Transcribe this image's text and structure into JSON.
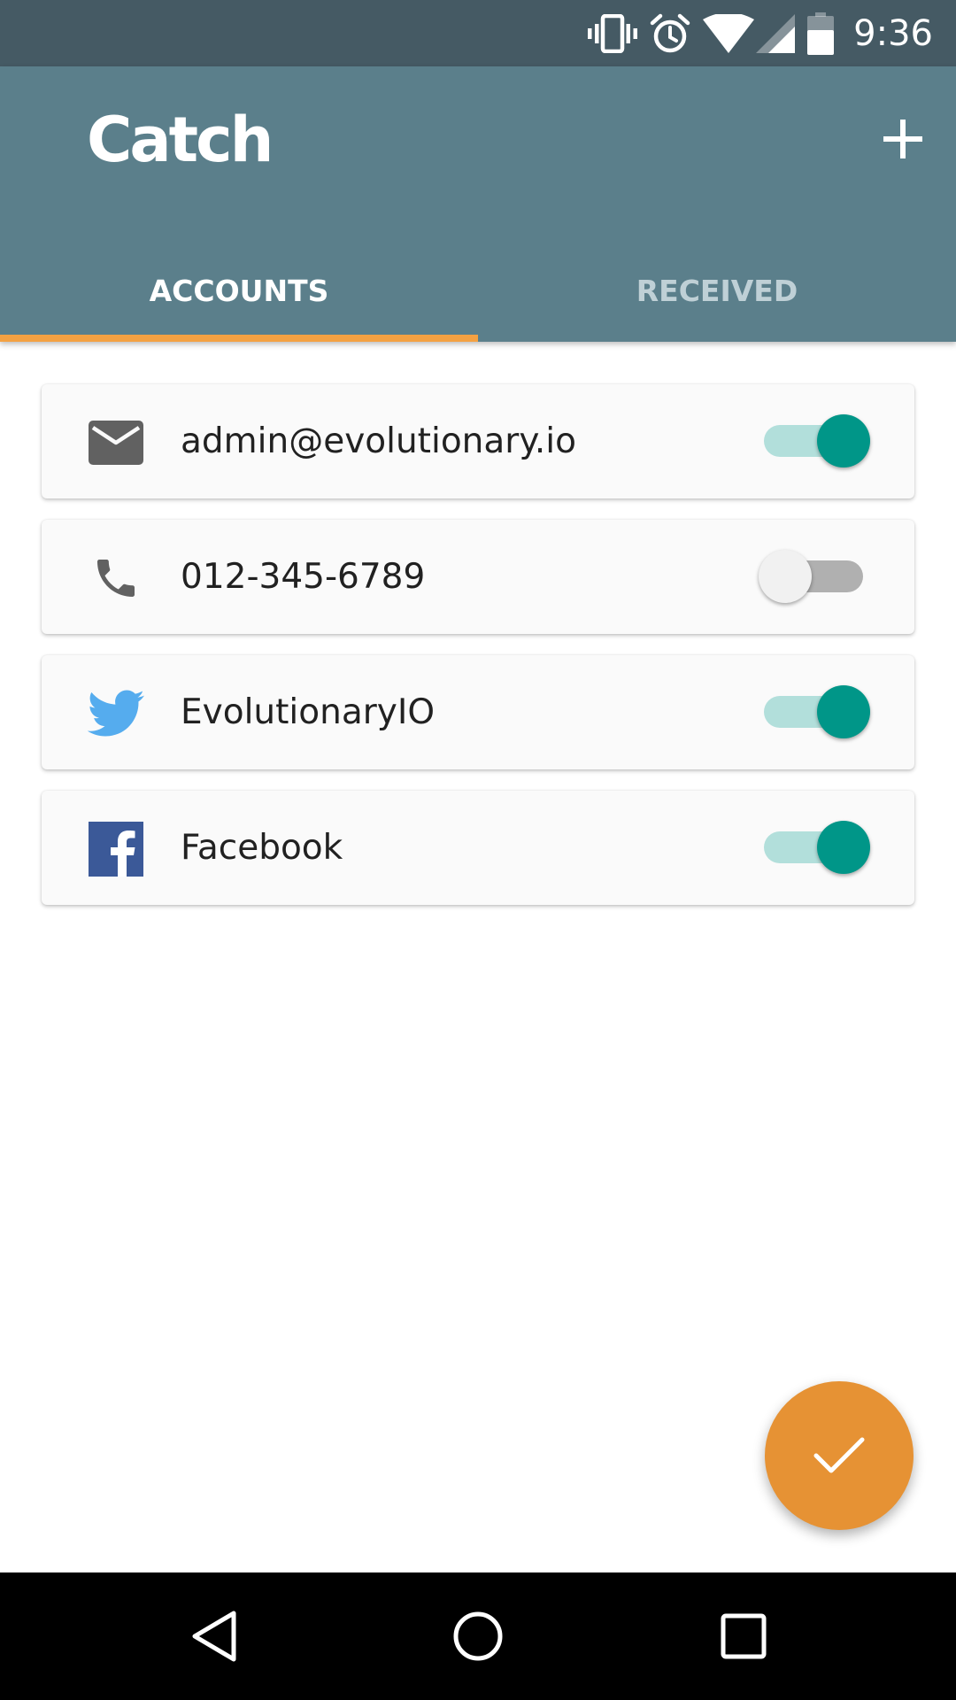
{
  "status_bar": {
    "time": "9:36",
    "icons": [
      "vibrate-icon",
      "alarm-icon",
      "wifi-icon",
      "signal-icon",
      "battery-icon"
    ]
  },
  "app_bar": {
    "title": "Catch",
    "add_icon": "plus-icon",
    "tabs": [
      {
        "label": "ACCOUNTS",
        "selected": true
      },
      {
        "label": "RECEIVED",
        "selected": false
      }
    ]
  },
  "accounts": [
    {
      "icon": "email-icon",
      "label": "admin@evolutionary.io",
      "enabled": true
    },
    {
      "icon": "phone-icon",
      "label": "012-345-6789",
      "enabled": false
    },
    {
      "icon": "twitter-icon",
      "label": "EvolutionaryIO",
      "enabled": true
    },
    {
      "icon": "facebook-icon",
      "label": "Facebook",
      "enabled": true
    }
  ],
  "fab": {
    "icon": "check-icon"
  },
  "nav_bar": {
    "buttons": [
      "back-icon",
      "home-icon",
      "recents-icon"
    ]
  },
  "colors": {
    "status_bar": "#455a64",
    "app_bar": "#5b7f8b",
    "tab_indicator": "#f4a142",
    "toggle_on_thumb": "#009688",
    "toggle_on_track": "#b2dfdb",
    "fab": "#e69234",
    "twitter": "#55acee",
    "facebook": "#3b5998"
  }
}
